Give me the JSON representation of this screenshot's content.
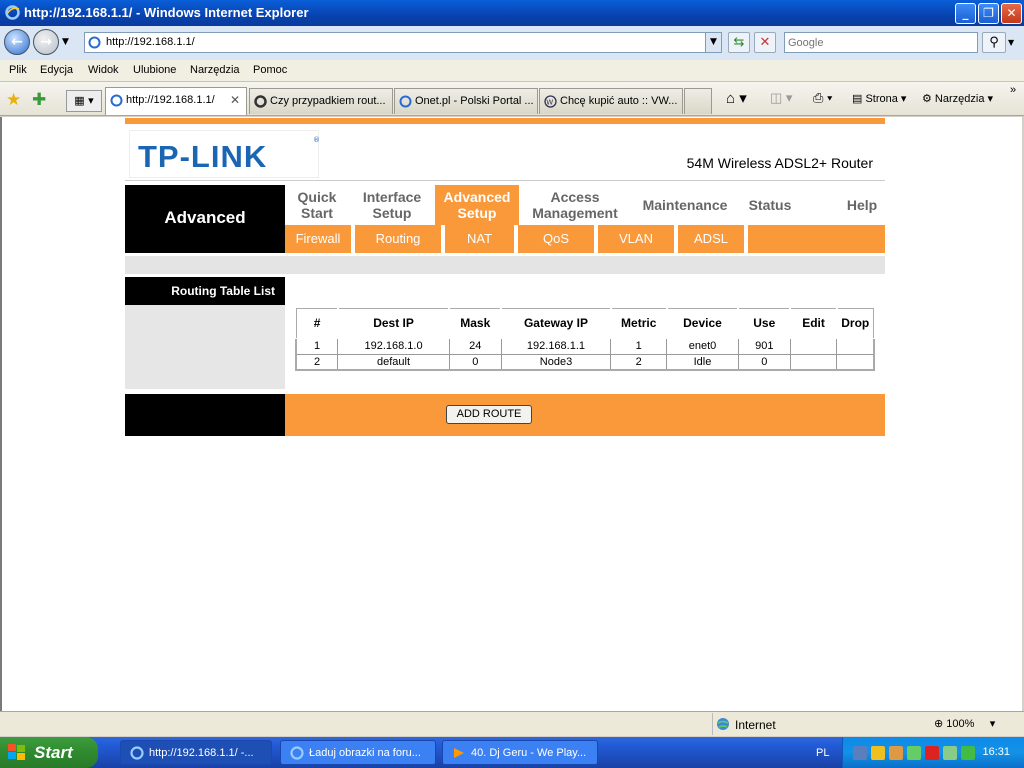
{
  "window": {
    "title": "http://192.168.1.1/ - Windows Internet Explorer"
  },
  "address": {
    "url": "http://192.168.1.1/"
  },
  "search": {
    "placeholder": "Google"
  },
  "menu": [
    "Plik",
    "Edycja",
    "Widok",
    "Ulubione",
    "Narzędzia",
    "Pomoc"
  ],
  "tabs": [
    {
      "label": "http://192.168.1.1/",
      "active": true
    },
    {
      "label": "Czy przypadkiem rout...",
      "active": false
    },
    {
      "label": "Onet.pl - Polski Portal ...",
      "active": false
    },
    {
      "label": "Chcę kupić auto :: VW...",
      "active": false
    }
  ],
  "commandbar": {
    "page": "Strona",
    "tools": "Narzędzia"
  },
  "router": {
    "brand": "TP-LINK",
    "model": "54M Wireless ADSL2+ Router",
    "section": "Advanced",
    "nav": [
      {
        "line1": "Quick",
        "line2": "Start"
      },
      {
        "line1": "Interface",
        "line2": "Setup"
      },
      {
        "line1": "Advanced",
        "line2": "Setup"
      },
      {
        "line1": "Access",
        "line2": "Management"
      },
      {
        "line1": "Maintenance",
        "line2": ""
      },
      {
        "line1": "Status",
        "line2": ""
      },
      {
        "line1": "Help",
        "line2": ""
      }
    ],
    "subnav": [
      "Firewall",
      "Routing",
      "NAT",
      "QoS",
      "VLAN",
      "ADSL"
    ],
    "side_title": "Routing Table List",
    "table": {
      "headers": [
        "#",
        "Dest IP",
        "Mask",
        "Gateway IP",
        "Metric",
        "Device",
        "Use",
        "Edit",
        "Drop"
      ],
      "rows": [
        [
          "1",
          "192.168.1.0",
          "24",
          "192.168.1.1",
          "1",
          "enet0",
          "901",
          "",
          ""
        ],
        [
          "2",
          "default",
          "0",
          "Node3",
          "2",
          "Idle",
          "0",
          "",
          ""
        ]
      ]
    },
    "add_route_label": "ADD ROUTE"
  },
  "status": {
    "zone": "Internet",
    "zoom": "100%"
  },
  "taskbar": {
    "start": "Start",
    "tasks": [
      {
        "label": "http://192.168.1.1/ -...",
        "active": true
      },
      {
        "label": "Ładuj obrazki na foru...",
        "active": false
      },
      {
        "label": "40. Dj Geru - We Play...",
        "active": false
      }
    ],
    "lang": "PL",
    "clock": "16:31"
  },
  "colors": {
    "router_orange": "#f9993a",
    "logo_blue": "#1a66b3",
    "xp_blue": "#245edb"
  }
}
